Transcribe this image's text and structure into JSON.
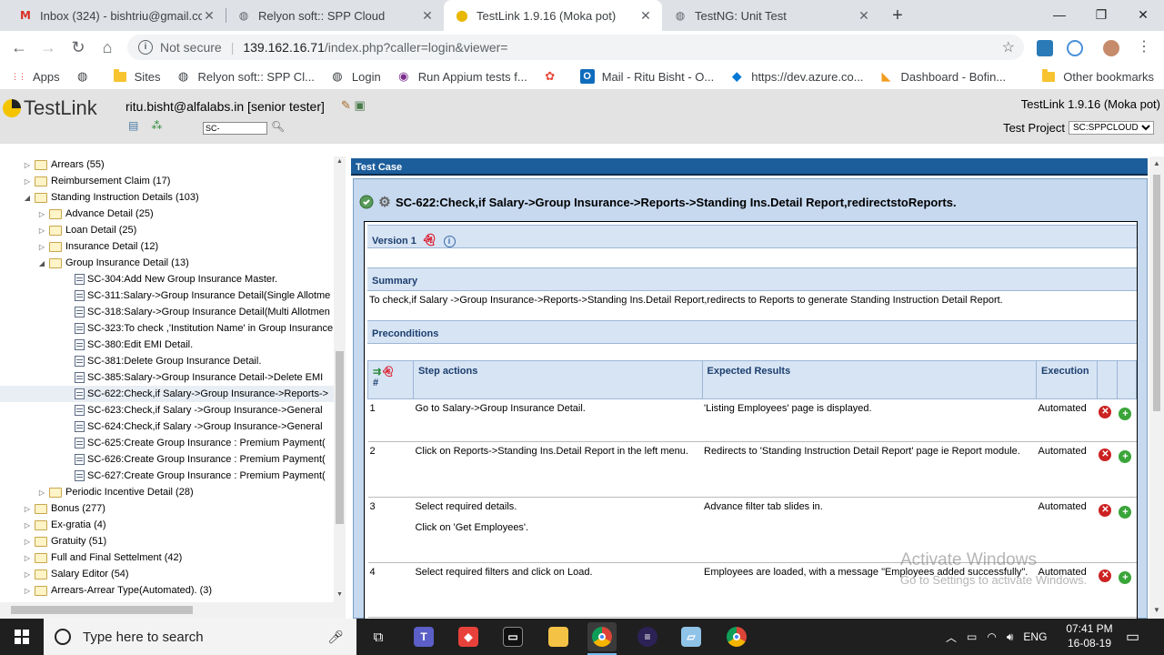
{
  "browser": {
    "tabs": [
      {
        "title": "Inbox (324) - bishtriu@gmail.com",
        "icon": "gmail-icon",
        "active": false
      },
      {
        "title": "Relyon soft:: SPP Cloud",
        "icon": "globe-icon",
        "active": false
      },
      {
        "title": "TestLink 1.9.16 (Moka pot)",
        "icon": "testlink-icon",
        "active": true
      },
      {
        "title": "TestNG: Unit Test",
        "icon": "globe-icon",
        "active": false
      }
    ],
    "address": {
      "security": "Not secure",
      "host": "139.162.16.71",
      "path": "/index.php?caller=login&viewer="
    },
    "bookmarks": [
      {
        "label": "Apps",
        "icon": "apps-icon"
      },
      {
        "label": "",
        "icon": "globe-icon"
      },
      {
        "label": "Sites",
        "icon": "folder-icon"
      },
      {
        "label": "Relyon soft:: SPP Cl...",
        "icon": "globe-icon"
      },
      {
        "label": "Login",
        "icon": "globe-icon"
      },
      {
        "label": "Run Appium tests f...",
        "icon": "appium-icon"
      },
      {
        "label": "",
        "icon": "flower-icon"
      },
      {
        "label": "Mail - Ritu Bisht - O...",
        "icon": "outlook-icon"
      },
      {
        "label": "https://dev.azure.co...",
        "icon": "azure-icon"
      },
      {
        "label": "Dashboard - Bofin...",
        "icon": "bofin-icon"
      }
    ],
    "other_bookmarks": "Other bookmarks"
  },
  "testlink": {
    "logo": "TestLink",
    "user": "ritu.bisht@alfalabs.in [senior tester]",
    "version": "TestLink 1.9.16 (Moka pot)",
    "search_value": "SC-",
    "project_label": "Test Project",
    "project_value": "SC:SPPCLOUD"
  },
  "tree": [
    {
      "level": 1,
      "type": "folder",
      "expander": "closed",
      "label": "Arrears (55)"
    },
    {
      "level": 1,
      "type": "folder",
      "expander": "closed",
      "label": "Reimbursement Claim (17)"
    },
    {
      "level": 1,
      "type": "folder",
      "expander": "open",
      "label": "Standing Instruction Details (103)"
    },
    {
      "level": 2,
      "type": "folder",
      "expander": "closed",
      "label": "Advance Detail (25)"
    },
    {
      "level": 2,
      "type": "folder",
      "expander": "closed",
      "label": "Loan Detail (25)"
    },
    {
      "level": 2,
      "type": "folder",
      "expander": "closed",
      "label": "Insurance Detail (12)"
    },
    {
      "level": 2,
      "type": "folder",
      "expander": "open",
      "label": "Group Insurance Detail (13)"
    },
    {
      "level": 3,
      "type": "case",
      "label": "SC-304:Add New Group Insurance Master."
    },
    {
      "level": 3,
      "type": "case",
      "label": "SC-311:Salary->Group Insurance Detail(Single Allotme"
    },
    {
      "level": 3,
      "type": "case",
      "label": "SC-318:Salary->Group Insurance Detail(Multi Allotmen"
    },
    {
      "level": 3,
      "type": "case",
      "label": "SC-323:To check ,'Institution Name' in Group Insurance"
    },
    {
      "level": 3,
      "type": "case",
      "label": "SC-380:Edit EMI Detail."
    },
    {
      "level": 3,
      "type": "case",
      "label": "SC-381:Delete Group Insurance Detail."
    },
    {
      "level": 3,
      "type": "case",
      "label": "SC-385:Salary->Group Insurance Detail->Delete EMI"
    },
    {
      "level": 3,
      "type": "case",
      "label": "SC-622:Check,if Salary->Group Insurance->Reports->",
      "selected": true
    },
    {
      "level": 3,
      "type": "case",
      "label": "SC-623:Check,if Salary ->Group Insurance->General"
    },
    {
      "level": 3,
      "type": "case",
      "label": "SC-624:Check,if Salary ->Group Insurance->General"
    },
    {
      "level": 3,
      "type": "case",
      "label": "SC-625:Create Group Insurance : Premium Payment("
    },
    {
      "level": 3,
      "type": "case",
      "label": "SC-626:Create Group Insurance : Premium Payment("
    },
    {
      "level": 3,
      "type": "case",
      "label": "SC-627:Create Group Insurance : Premium Payment("
    },
    {
      "level": 2,
      "type": "folder",
      "expander": "closed",
      "label": "Periodic Incentive Detail (28)"
    },
    {
      "level": 1,
      "type": "folder",
      "expander": "closed",
      "label": "Bonus (277)"
    },
    {
      "level": 1,
      "type": "folder",
      "expander": "closed",
      "label": "Ex-gratia (4)"
    },
    {
      "level": 1,
      "type": "folder",
      "expander": "closed",
      "label": "Gratuity (51)"
    },
    {
      "level": 1,
      "type": "folder",
      "expander": "closed",
      "label": "Full and Final Settelment (42)"
    },
    {
      "level": 1,
      "type": "folder",
      "expander": "closed",
      "label": "Salary Editor (54)"
    },
    {
      "level": 1,
      "type": "folder",
      "expander": "closed",
      "label": "Arrears-Arrear Type(Automated). (3)"
    }
  ],
  "testcase": {
    "panel_title": "Test Case",
    "heading": "SC-622:Check,if Salary->Group Insurance->Reports->Standing Ins.Detail Report,redirectstoReports.",
    "version_label": "Version 1",
    "summary_label": "Summary",
    "summary_text": "To check,if Salary ->Group Insurance->Reports->Standing Ins.Detail Report,redirects to Reports to generate Standing Instruction Detail Report.",
    "preconditions_label": "Preconditions",
    "columns": {
      "num": "#",
      "actions": "Step actions",
      "expected": "Expected Results",
      "execution": "Execution"
    },
    "steps": [
      {
        "num": "1",
        "action": "Go to Salary->Group Insurance Detail.",
        "action2": "",
        "expected": "'Listing Employees' page is displayed.",
        "execution": "Automated"
      },
      {
        "num": "2",
        "action": "Click on Reports->Standing Ins.Detail Report in the left menu.",
        "action2": "",
        "expected": "Redirects to 'Standing Instruction Detail Report' page ie Report module.",
        "execution": "Automated"
      },
      {
        "num": "3",
        "action": "Select required details.",
        "action2": "Click on 'Get Employees'.",
        "expected": "Advance filter tab slides in.",
        "execution": "Automated"
      },
      {
        "num": "4",
        "action": "Select required filters and click on Load.",
        "action2": "",
        "expected": "Employees are loaded, with a message \"Employees added successfully\".",
        "execution": "Automated"
      }
    ]
  },
  "watermark": {
    "line1": "Activate Windows",
    "line2": "Go to Settings to activate Windows."
  },
  "taskbar": {
    "search_placeholder": "Type here to search",
    "language": "ENG",
    "time": "07:41 PM",
    "date": "16-08-19"
  }
}
